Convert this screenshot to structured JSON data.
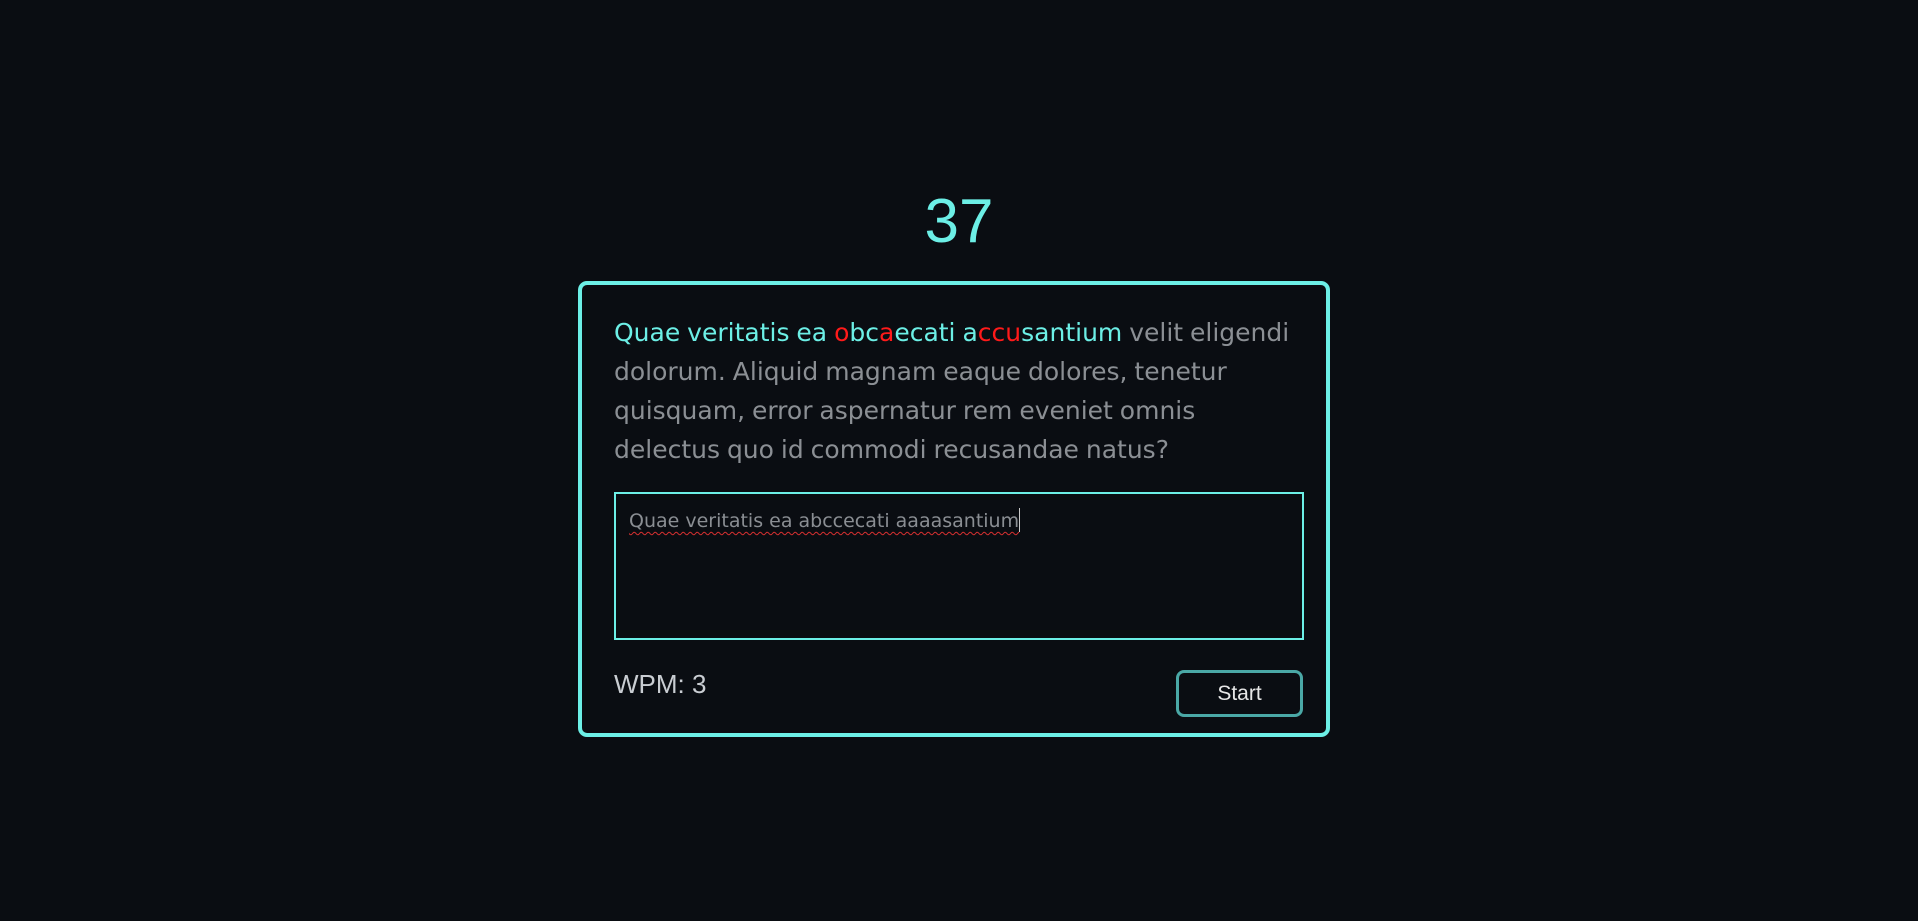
{
  "timer": {
    "seconds_remaining": "37"
  },
  "quote": {
    "segments": [
      {
        "text": "Quae veritatis ea ",
        "state": "ok"
      },
      {
        "text": "o",
        "state": "bad"
      },
      {
        "text": "bc",
        "state": "ok"
      },
      {
        "text": "a",
        "state": "bad"
      },
      {
        "text": "ecati ",
        "state": "ok"
      },
      {
        "text": "a",
        "state": "ok"
      },
      {
        "text": "ccu",
        "state": "bad"
      },
      {
        "text": "santium",
        "state": "ok"
      },
      {
        "text": " velit eligendi dolorum. Aliquid magnam eaque dolores, tenetur quisquam, error aspernatur rem eveniet omnis delectus quo id commodi recusandae natus?",
        "state": "pending"
      }
    ]
  },
  "input": {
    "value": "Quae veritatis ea abccecati aaaasantium"
  },
  "stats": {
    "wpm_label": "WPM: 3"
  },
  "controls": {
    "start_label": "Start"
  },
  "colors": {
    "accent": "#6cefe6",
    "error": "#ff1a1a",
    "pending": "#8b8f94",
    "background": "#0a0d12"
  }
}
